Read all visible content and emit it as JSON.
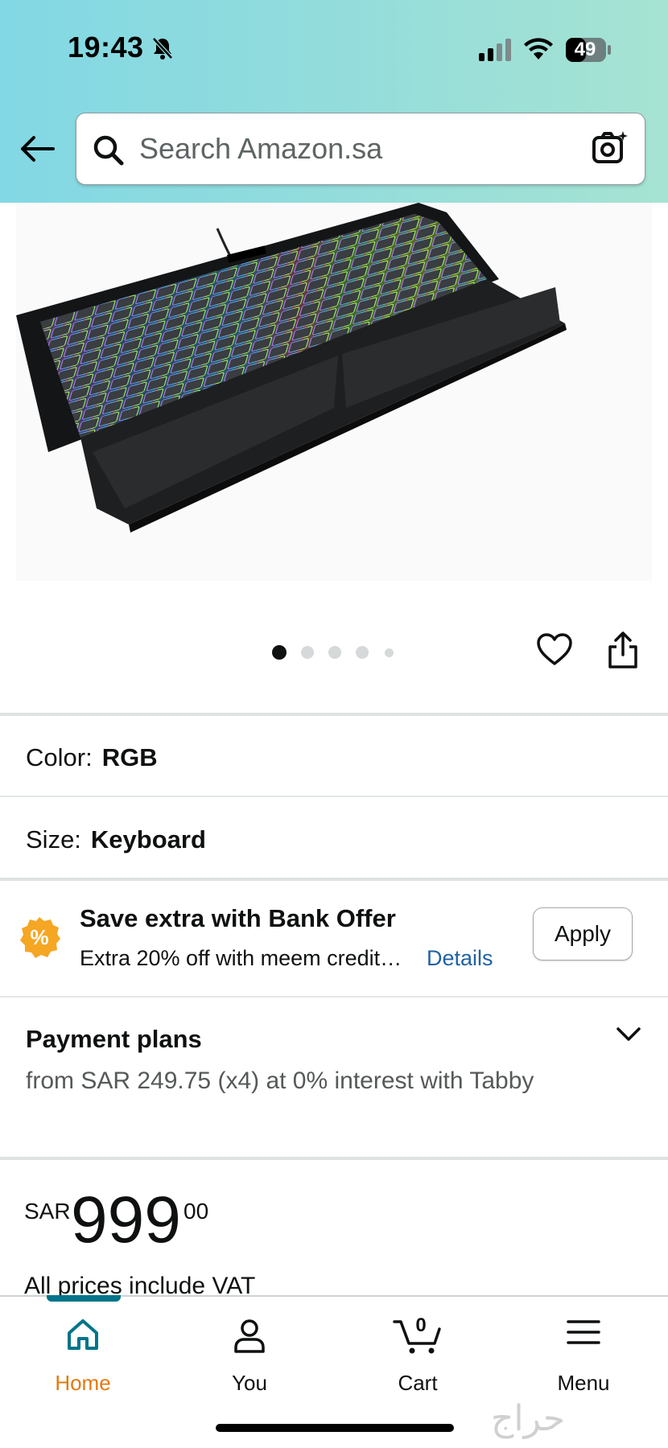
{
  "status_bar": {
    "time": "19:43",
    "battery": "49"
  },
  "search": {
    "placeholder": "Search Amazon.sa"
  },
  "product": {
    "image_alt": "Keyboard",
    "image_count": 5,
    "active_image": 0,
    "options": [
      {
        "label": "Color:",
        "value": "RGB"
      },
      {
        "label": "Size:",
        "value": "Keyboard"
      }
    ]
  },
  "bank_offer": {
    "title": "Save extra with Bank Offer",
    "description": "Extra 20% off with meem credit…",
    "link": "Details",
    "button": "Apply",
    "badge_symbol": "%"
  },
  "payment_plans": {
    "title": "Payment plans",
    "description": "from SAR 249.75 (x4) at 0% interest with Tabby"
  },
  "price": {
    "currency": "SAR",
    "whole": "999",
    "fraction": "00",
    "vat_note": "All prices include VAT"
  },
  "bottom_nav": {
    "items": [
      {
        "label": "Home",
        "icon": "home-icon",
        "active": true
      },
      {
        "label": "You",
        "icon": "person-icon",
        "active": false
      },
      {
        "label": "Cart",
        "icon": "cart-icon",
        "active": false,
        "count": "0"
      },
      {
        "label": "Menu",
        "icon": "menu-icon",
        "active": false
      }
    ]
  },
  "watermark": "حراج",
  "colors": {
    "accent_teal": "#00748a",
    "active_orange": "#e47911",
    "link_blue": "#2162a1",
    "badge_orange": "#f5a623"
  }
}
